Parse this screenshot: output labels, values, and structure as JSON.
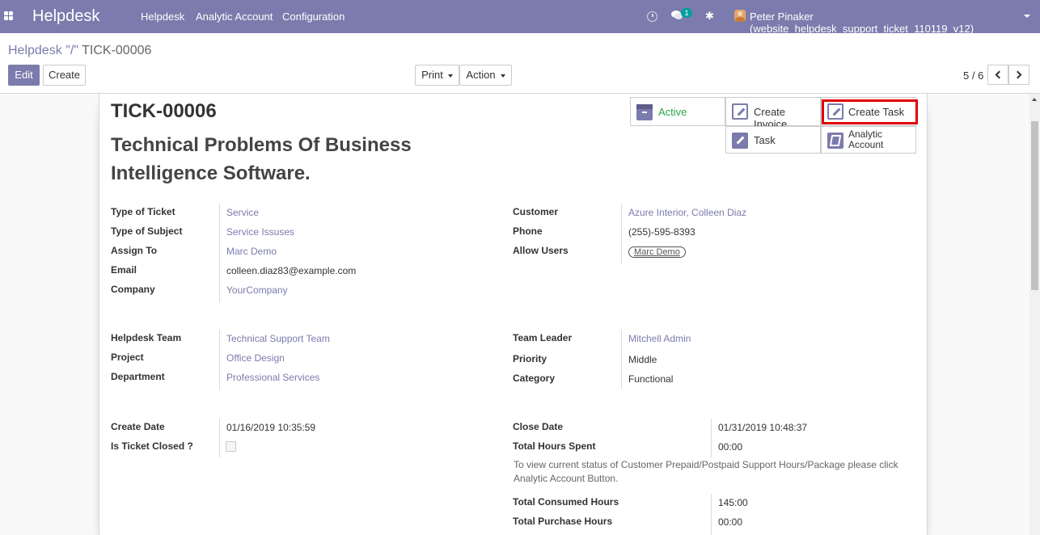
{
  "navbar": {
    "brand": "Helpdesk",
    "menu": [
      "Helpdesk",
      "Analytic Account",
      "Configuration"
    ],
    "chat_badge": "1",
    "user": "Peter Pinaker (website_helpdesk_support_ticket_110119_v12)",
    "color": "#7c7bad"
  },
  "breadcrumb": {
    "parent": "Helpdesk",
    "separator": "\"/\"",
    "current": "TICK-00006"
  },
  "buttons": {
    "edit": "Edit",
    "create": "Create",
    "print": "Print",
    "action": "Action"
  },
  "pager": {
    "value": "5 / 6"
  },
  "record": {
    "number": "TICK-00006",
    "title": "Technical Problems Of Business Intelligence Software."
  },
  "button_box": {
    "active": "Active",
    "create_invoice": "Create Invoice",
    "create_task": "Create Task",
    "task": "Task",
    "analytic_account": "Analytic Account"
  },
  "group1_left": [
    {
      "label": "Type of Ticket",
      "value": "Service"
    },
    {
      "label": "Type of Subject",
      "value": "Service Issuses"
    },
    {
      "label": "Assign To",
      "value": "Marc Demo"
    },
    {
      "label": "Email",
      "value": "colleen.diaz83@example.com"
    },
    {
      "label": "Company",
      "value": "YourCompany"
    }
  ],
  "group1_right": [
    {
      "label": "Customer",
      "value": "Azure Interior, Colleen Diaz"
    },
    {
      "label": "Phone",
      "value": "(255)-595-8393"
    },
    {
      "label": "Allow Users",
      "value": "Marc Demo"
    }
  ],
  "group2_left": [
    {
      "label": "Helpdesk Team",
      "value": "Technical Support Team"
    },
    {
      "label": "Project",
      "value": "Office Design"
    },
    {
      "label": "Department",
      "value": "Professional Services"
    }
  ],
  "group2_right": [
    {
      "label": "Team Leader",
      "value": "Mitchell Admin"
    },
    {
      "label": "Priority",
      "value": "Middle"
    },
    {
      "label": "Category",
      "value": "Functional"
    }
  ],
  "group3_left": [
    {
      "label": "Create Date",
      "value": "01/16/2019 10:35:59"
    },
    {
      "label": "Is Ticket Closed ?",
      "value": ""
    }
  ],
  "group3_right": [
    {
      "label": "Close Date",
      "value": "01/31/2019 10:48:37"
    },
    {
      "label": "Total Hours Spent",
      "value": "00:00"
    },
    {
      "label": "Total Consumed Hours",
      "value": "145:00"
    },
    {
      "label": "Total Purchase Hours",
      "value": "00:00"
    }
  ],
  "help_text": "To view current status of Customer Prepaid/Postpaid Support Hours/Package please click Analytic Account Button."
}
